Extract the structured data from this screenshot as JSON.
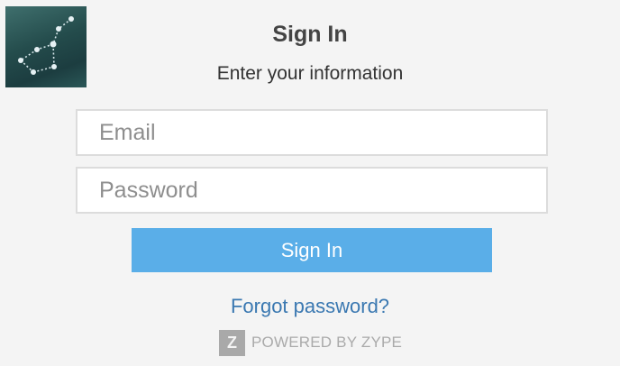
{
  "header": {
    "title": "Sign In",
    "subtitle": "Enter your information"
  },
  "logo": {
    "icon": "constellation-icon"
  },
  "form": {
    "email_placeholder": "Email",
    "email_value": "",
    "password_placeholder": "Password",
    "password_value": "",
    "submit_label": "Sign In",
    "forgot_label": "Forgot password?"
  },
  "footer": {
    "badge_letter": "Z",
    "powered_label": "POWERED BY ZYPE"
  },
  "colors": {
    "button": "#5aaee8",
    "link": "#3a78b1",
    "background": "#f4f4f4"
  }
}
